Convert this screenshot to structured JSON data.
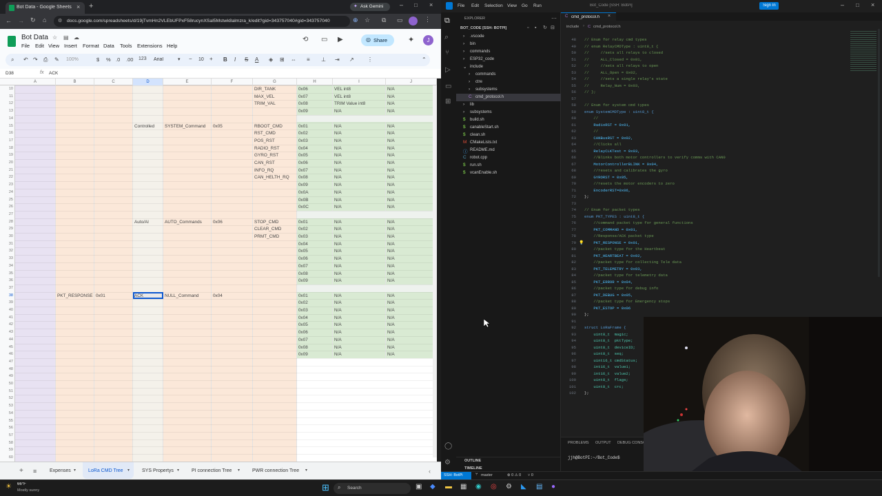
{
  "chrome": {
    "tab_title": "Bot Data - Google Sheets",
    "gemini": "Ask Gemini",
    "url": "docs.google.com/spreadsheets/d/19jTvmHn2VLEbUFPxF58rucynXSal5Mstwk8almzra_k/edit?gid=343757040#gid=343757040"
  },
  "sheets": {
    "doc_title": "Bot Data",
    "menu": [
      "File",
      "Edit",
      "View",
      "Insert",
      "Format",
      "Data",
      "Tools",
      "Extensions",
      "Help"
    ],
    "share": "Share",
    "avatar": "J",
    "zoom": "100%",
    "font": "Arial",
    "font_size": "10",
    "cell_ref": "D38",
    "formula": "ACK",
    "columns": [
      "A",
      "B",
      "C",
      "D",
      "E",
      "F",
      "G",
      "H",
      "I",
      "J"
    ],
    "rows": [
      {
        "n": "10",
        "g": "DIR_TANK",
        "h": "0x06",
        "i": "VEL int8",
        "j": "N/A"
      },
      {
        "n": "11",
        "g": "MAX_VEL",
        "h": "0x07",
        "i": "VEL int8",
        "j": "N/A"
      },
      {
        "n": "12",
        "g": "TRIM_VAL",
        "h": "0x08",
        "i": "TRIM Value int8",
        "j": "N/A"
      },
      {
        "n": "13",
        "h": "0x09",
        "i": "N/A",
        "j": "N/A"
      },
      {
        "n": "14"
      },
      {
        "n": "15",
        "d": "Controlled",
        "e": "SYSTEM_Command",
        "f": "0x05",
        "g": "RBOOT_CMD",
        "h": "0x01",
        "i": "N/A",
        "j": "N/A"
      },
      {
        "n": "16",
        "g": "RST_CMD",
        "h": "0x02",
        "i": "N/A",
        "j": "N/A"
      },
      {
        "n": "17",
        "g": "POS_RST",
        "h": "0x03",
        "i": "N/A",
        "j": "N/A"
      },
      {
        "n": "18",
        "g": "RADIO_RST",
        "h": "0x04",
        "i": "N/A",
        "j": "N/A"
      },
      {
        "n": "19",
        "g": "GYRO_RST",
        "h": "0x05",
        "i": "N/A",
        "j": "N/A"
      },
      {
        "n": "20",
        "g": "CAN_RST",
        "h": "0x06",
        "i": "N/A",
        "j": "N/A"
      },
      {
        "n": "21",
        "g": "INFO_RQ",
        "h": "0x07",
        "i": "N/A",
        "j": "N/A"
      },
      {
        "n": "22",
        "g": "CAN_HELTH_RQ",
        "h": "0x08",
        "i": "N/A",
        "j": "N/A"
      },
      {
        "n": "23",
        "h": "0x09",
        "i": "N/A",
        "j": "N/A"
      },
      {
        "n": "24",
        "h": "0x0A",
        "i": "N/A",
        "j": "N/A"
      },
      {
        "n": "25",
        "h": "0x0B",
        "i": "N/A",
        "j": "N/A"
      },
      {
        "n": "26",
        "h": "0x0C",
        "i": "N/A",
        "j": "N/A"
      },
      {
        "n": "27"
      },
      {
        "n": "28",
        "d": "Auto/AI",
        "e": "AUTO_Commands",
        "f": "0x06",
        "g": "STOP_CMD",
        "h": "0x01",
        "i": "N/A",
        "j": "N/A"
      },
      {
        "n": "29",
        "g": "CLEAR_CMD",
        "h": "0x02",
        "i": "N/A",
        "j": "N/A"
      },
      {
        "n": "30",
        "g": "PRMT_CMD",
        "h": "0x03",
        "i": "N/A",
        "j": "N/A"
      },
      {
        "n": "31",
        "h": "0x04",
        "i": "N/A",
        "j": "N/A"
      },
      {
        "n": "32",
        "h": "0x05",
        "i": "N/A",
        "j": "N/A"
      },
      {
        "n": "33",
        "h": "0x06",
        "i": "N/A",
        "j": "N/A"
      },
      {
        "n": "34",
        "h": "0x07",
        "i": "N/A",
        "j": "N/A"
      },
      {
        "n": "35",
        "h": "0x08",
        "i": "N/A",
        "j": "N/A"
      },
      {
        "n": "36",
        "h": "0x09",
        "i": "N/A",
        "j": "N/A"
      },
      {
        "n": "37"
      },
      {
        "n": "38",
        "b": "PKT_RESPONSE",
        "c": "0x01",
        "d": "ACK",
        "e": "NULL_Command",
        "f": "0x04",
        "h": "0x01",
        "i": "N/A",
        "j": "N/A"
      },
      {
        "n": "39",
        "h": "0x02",
        "i": "N/A",
        "j": "N/A"
      },
      {
        "n": "40",
        "h": "0x03",
        "i": "N/A",
        "j": "N/A"
      },
      {
        "n": "41",
        "h": "0x04",
        "i": "N/A",
        "j": "N/A"
      },
      {
        "n": "42",
        "h": "0x05",
        "i": "N/A",
        "j": "N/A"
      },
      {
        "n": "43",
        "h": "0x06",
        "i": "N/A",
        "j": "N/A"
      },
      {
        "n": "44",
        "h": "0x07",
        "i": "N/A",
        "j": "N/A"
      },
      {
        "n": "45",
        "h": "0x08",
        "i": "N/A",
        "j": "N/A"
      },
      {
        "n": "46",
        "h": "0x09",
        "i": "N/A",
        "j": "N/A"
      },
      {
        "n": "47"
      },
      {
        "n": "48"
      },
      {
        "n": "49"
      },
      {
        "n": "50"
      },
      {
        "n": "51"
      },
      {
        "n": "52"
      },
      {
        "n": "53"
      },
      {
        "n": "54"
      },
      {
        "n": "55"
      },
      {
        "n": "56"
      },
      {
        "n": "57"
      },
      {
        "n": "58"
      },
      {
        "n": "59"
      },
      {
        "n": "60"
      },
      {
        "n": "61"
      },
      {
        "n": "62"
      },
      {
        "n": "63"
      },
      {
        "n": "64"
      },
      {
        "n": "65"
      },
      {
        "n": "66"
      },
      {
        "n": "67"
      }
    ],
    "tabs": [
      "Expenses",
      "LoRa CMD Tree",
      "SYS Propertys",
      "PI connection Tree",
      "PWR connection Tree"
    ],
    "active_tab": 1
  },
  "vscode": {
    "menu": [
      "File",
      "Edit",
      "Selection",
      "View",
      "Go",
      "Run"
    ],
    "search": "Bot_Code [SSH: BotPi]",
    "signin": "Sign In",
    "explorer_title": "EXPLORER",
    "root": "BOT_CODE [SSH: BOTPI]",
    "tree": [
      {
        "label": ".vscode",
        "d": 1,
        "k": "folder"
      },
      {
        "label": "bin",
        "d": 1,
        "k": "folder"
      },
      {
        "label": "commands",
        "d": 1,
        "k": "folder"
      },
      {
        "label": "ESP32_code",
        "d": 1,
        "k": "folder"
      },
      {
        "label": "include",
        "d": 1,
        "k": "open"
      },
      {
        "label": "commands",
        "d": 2,
        "k": "folder"
      },
      {
        "label": "ctre",
        "d": 2,
        "k": "folder"
      },
      {
        "label": "subsystems",
        "d": 2,
        "k": "folder"
      },
      {
        "label": "cmd_protocol.h",
        "d": 2,
        "k": "c"
      },
      {
        "label": "lib",
        "d": 1,
        "k": "folder"
      },
      {
        "label": "subsystems",
        "d": 1,
        "k": "folder"
      },
      {
        "label": "build.sh",
        "d": 1,
        "k": "sh"
      },
      {
        "label": "canableStart.sh",
        "d": 1,
        "k": "sh"
      },
      {
        "label": "clean.sh",
        "d": 1,
        "k": "sh"
      },
      {
        "label": "CMakeLists.txt",
        "d": 1,
        "k": "m"
      },
      {
        "label": "README.md",
        "d": 1,
        "k": "md"
      },
      {
        "label": "robot.cpp",
        "d": 1,
        "k": "cpp"
      },
      {
        "label": "run.sh",
        "d": 1,
        "k": "sh"
      },
      {
        "label": "vcanEnable.sh",
        "d": 1,
        "k": "sh"
      }
    ],
    "outline": "OUTLINE",
    "timeline": "TIMELINE",
    "editor_tab": "cmd_protocol.h",
    "breadcrumb": [
      "include",
      "cmd_protocol.h"
    ],
    "code": [
      {
        "n": "48",
        "t": "// Enum for relay cmd types",
        "c": "cm"
      },
      {
        "n": "49",
        "t": "// enum RelayCMDType : uint8_t {",
        "c": "cm"
      },
      {
        "n": "50",
        "t": "//     //sets all relays to closed",
        "c": "cm"
      },
      {
        "n": "51",
        "t": "//     ALL_Closed = 0x01,",
        "c": "cm"
      },
      {
        "n": "52",
        "t": "//     //sets all relays to open",
        "c": "cm"
      },
      {
        "n": "53",
        "t": "//     ALL_Open = 0x02,",
        "c": "cm"
      },
      {
        "n": "54",
        "t": "//     //sets a single relay's state",
        "c": "cm"
      },
      {
        "n": "55",
        "t": "//     Relay_Num = 0x03,",
        "c": "cm"
      },
      {
        "n": "56",
        "t": "// };",
        "c": "cm"
      },
      {
        "n": "57",
        "t": "",
        "c": "cm"
      },
      {
        "n": "58",
        "t": "// Enum for system cmd types",
        "c": "cm"
      },
      {
        "n": "59",
        "t": "enum SystemCMDType : uint8_t {",
        "c": "kw"
      },
      {
        "n": "60",
        "t": "    //",
        "c": "cm"
      },
      {
        "n": "61",
        "t": "    RadioRST = 0x01,",
        "c": "id"
      },
      {
        "n": "62",
        "t": "    //",
        "c": "cm"
      },
      {
        "n": "63",
        "t": "    CANBusRST = 0x02,",
        "c": "id"
      },
      {
        "n": "64",
        "t": "    //Clicks all",
        "c": "cm"
      },
      {
        "n": "65",
        "t": "    RelayCLKTest = 0x03,",
        "c": "id"
      },
      {
        "n": "66",
        "t": "    //Blinks both motor controllers to verify comms with CAN0",
        "c": "cm"
      },
      {
        "n": "67",
        "t": "    MotorControllerBLINK = 0x04,",
        "c": "id"
      },
      {
        "n": "68",
        "t": "    //resets and calibrates the gyro",
        "c": "cm"
      },
      {
        "n": "69",
        "t": "    GYRORST = 0x05,",
        "c": "id"
      },
      {
        "n": "70",
        "t": "    //resets the motor encoders to zero",
        "c": "cm"
      },
      {
        "n": "71",
        "t": "    EncoderRST=0x06,",
        "c": "id"
      },
      {
        "n": "72",
        "t": "};",
        "c": "pl"
      },
      {
        "n": "73",
        "t": "",
        "c": "pl"
      },
      {
        "n": "74",
        "t": "// Enum for packet types",
        "c": "cm"
      },
      {
        "n": "75",
        "t": "enum PKT_TYPES : uint8_t {",
        "c": "kw"
      },
      {
        "n": "76",
        "t": "    //command packet type for general functions",
        "c": "cm"
      },
      {
        "n": "77",
        "t": "    PKT_COMMAND = 0x01,",
        "c": "id"
      },
      {
        "n": "78",
        "t": "    //Response/ACK packet type",
        "c": "cm"
      },
      {
        "n": "79",
        "t": "    PKT_RESPONSE = 0x01,",
        "c": "id"
      },
      {
        "n": "80",
        "t": "    //packet type for the Heartbeat",
        "c": "cm"
      },
      {
        "n": "81",
        "t": "    PKT_HEARTBEAT = 0x02,",
        "c": "id"
      },
      {
        "n": "82",
        "t": "    //packet type for collecting Tele data",
        "c": "cm"
      },
      {
        "n": "83",
        "t": "    PKT_TELEMETRY = 0x03,",
        "c": "id"
      },
      {
        "n": "84",
        "t": "    //packet type for telemetry data",
        "c": "cm"
      },
      {
        "n": "85",
        "t": "    PKT_ERROR = 0x04,",
        "c": "id"
      },
      {
        "n": "86",
        "t": "    //packet type for debug info",
        "c": "cm"
      },
      {
        "n": "87",
        "t": "    PKT_DEBUG = 0x05,",
        "c": "id"
      },
      {
        "n": "88",
        "t": "    //packet type for Emergency stops",
        "c": "cm"
      },
      {
        "n": "89",
        "t": "    PKT_ESTOP = 0x06",
        "c": "id"
      },
      {
        "n": "90",
        "t": "};",
        "c": "pl"
      },
      {
        "n": "91",
        "t": "",
        "c": "pl"
      },
      {
        "n": "92",
        "t": "struct LoRaFrame {",
        "c": "kw"
      },
      {
        "n": "93",
        "t": "    uint8_t  magic;",
        "c": "ty"
      },
      {
        "n": "94",
        "t": "    uint8_t  pktType;",
        "c": "ty"
      },
      {
        "n": "95",
        "t": "    uint8_t  deviceID;",
        "c": "ty"
      },
      {
        "n": "96",
        "t": "    uint8_t  seq;",
        "c": "ty"
      },
      {
        "n": "97",
        "t": "    uint16_t cmdStatus;",
        "c": "ty"
      },
      {
        "n": "98",
        "t": "    int16_t  value1;",
        "c": "ty"
      },
      {
        "n": "99",
        "t": "    int16_t  value2;",
        "c": "ty"
      },
      {
        "n": "100",
        "t": "    uint8_t  flags;",
        "c": "ty"
      },
      {
        "n": "101",
        "t": "    uint8_t  crc;",
        "c": "ty"
      },
      {
        "n": "102",
        "t": "};",
        "c": "pl"
      }
    ],
    "panel_tabs": [
      "PROBLEMS",
      "OUTPUT",
      "DEBUG CONSOLE"
    ],
    "terminal": "jjh@BotPI:~/Bot_Code$",
    "status": {
      "remote": "SSH: BotPi",
      "branch": "master",
      "problems": "⊗ 0 ⚠ 0",
      "ports": "⑂ 0"
    }
  },
  "taskbar": {
    "temp": "66°F",
    "weather": "Mostly sunny",
    "search": "Search"
  },
  "colors": {
    "sheet_green": "#d9ead3",
    "sheet_peach": "#fce5cd",
    "sheet_purple": "#e6e0f0",
    "vs_blue": "#0078d4",
    "sheets_green": "#0f9d58"
  }
}
